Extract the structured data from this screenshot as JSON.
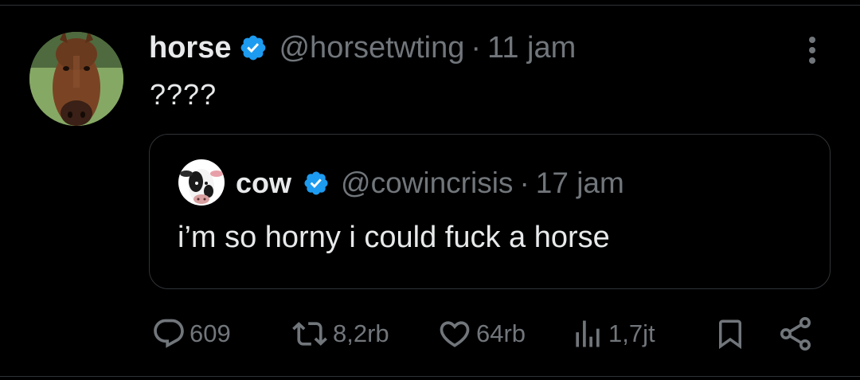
{
  "tweet": {
    "author": {
      "display_name": "horse",
      "handle": "@horsetwting",
      "verified": true,
      "avatar_icon": "horse-avatar"
    },
    "separator": "·",
    "timestamp": "11 jam",
    "text": "????",
    "more_icon": "more-vertical-icon"
  },
  "quoted_tweet": {
    "author": {
      "display_name": "cow",
      "handle": "@cowincrisis",
      "verified": true,
      "avatar_icon": "cow-avatar"
    },
    "separator": "·",
    "timestamp": "17 jam",
    "text": "i’m so horny i could fuck a horse"
  },
  "actions": {
    "replies": {
      "icon": "reply-icon",
      "count": "609"
    },
    "reposts": {
      "icon": "repost-icon",
      "count": "8,2rb"
    },
    "likes": {
      "icon": "like-icon",
      "count": "64rb"
    },
    "views": {
      "icon": "views-icon",
      "count": "1,7jt"
    },
    "bookmark": {
      "icon": "bookmark-icon"
    },
    "share": {
      "icon": "share-icon"
    }
  },
  "colors": {
    "background": "#000000",
    "text_primary": "#e7e9ea",
    "text_secondary": "#71767b",
    "border": "#2f3336",
    "verified_blue": "#1d9bf0"
  }
}
